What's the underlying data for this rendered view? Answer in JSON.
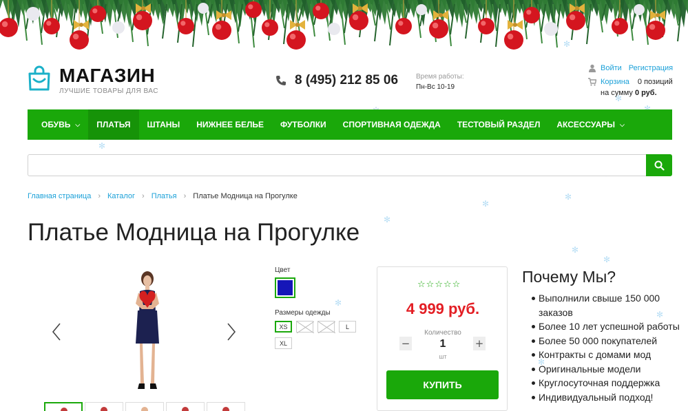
{
  "header": {
    "logo_name": "МАГАЗИН",
    "logo_tagline": "ЛУЧШИЕ ТОВАРЫ ДЛЯ ВАС",
    "phone": "8 (495) 212 85 06",
    "hours_label": "Время работы:",
    "hours_value": "Пн-Вс 10-19",
    "login_link": "Войти",
    "register_link": "Регистрация",
    "cart_link": "Корзина",
    "cart_count": "0 позиций",
    "cart_sum_prefix": "на сумму",
    "cart_sum": "0 руб."
  },
  "nav": {
    "items": [
      {
        "label": "Обувь",
        "has_dropdown": true,
        "active": false
      },
      {
        "label": "Платья",
        "has_dropdown": false,
        "active": true
      },
      {
        "label": "Штаны",
        "has_dropdown": false,
        "active": false
      },
      {
        "label": "Нижнее белье",
        "has_dropdown": false,
        "active": false
      },
      {
        "label": "Футболки",
        "has_dropdown": false,
        "active": false
      },
      {
        "label": "Спортивная одежда",
        "has_dropdown": false,
        "active": false
      },
      {
        "label": "Тестовый раздел",
        "has_dropdown": false,
        "active": false
      },
      {
        "label": "Аксессуары",
        "has_dropdown": true,
        "active": false
      }
    ]
  },
  "search": {
    "value": "",
    "placeholder": ""
  },
  "breadcrumb": {
    "items": [
      "Главная страница",
      "Каталог",
      "Платья"
    ],
    "current": "Платье Модница на Прогулке"
  },
  "product": {
    "title": "Платье Модница на Прогулке",
    "color_label": "Цвет",
    "selected_color": "#1516b8",
    "size_label": "Размеры одежды",
    "sizes": [
      {
        "label": "XS",
        "available": true,
        "selected": true
      },
      {
        "label": "",
        "available": false,
        "selected": false
      },
      {
        "label": "",
        "available": false,
        "selected": false
      },
      {
        "label": "L",
        "available": true,
        "selected": false
      },
      {
        "label": "XL",
        "available": true,
        "selected": false
      }
    ],
    "rating": 0,
    "price": "4 999 руб.",
    "quantity_label": "Количество",
    "quantity": "1",
    "unit": "шт",
    "buy_label": "КУПИТЬ",
    "thumbnail_count": 5
  },
  "why_us": {
    "title": "Почему Мы?",
    "items": [
      "Выполнили свыше 150 000 заказов",
      "Более 10 лет успешной работы",
      "Более 50 000 покупателей",
      "Контракты с домами мод",
      "Оригинальные модели",
      "Круглосуточная поддержка",
      "Индивидуальный подход!"
    ]
  },
  "colors": {
    "accent_green": "#1aa80a",
    "price_red": "#e31e24",
    "link_blue": "#1aa0d8",
    "logo_teal": "#1bb0c8"
  }
}
